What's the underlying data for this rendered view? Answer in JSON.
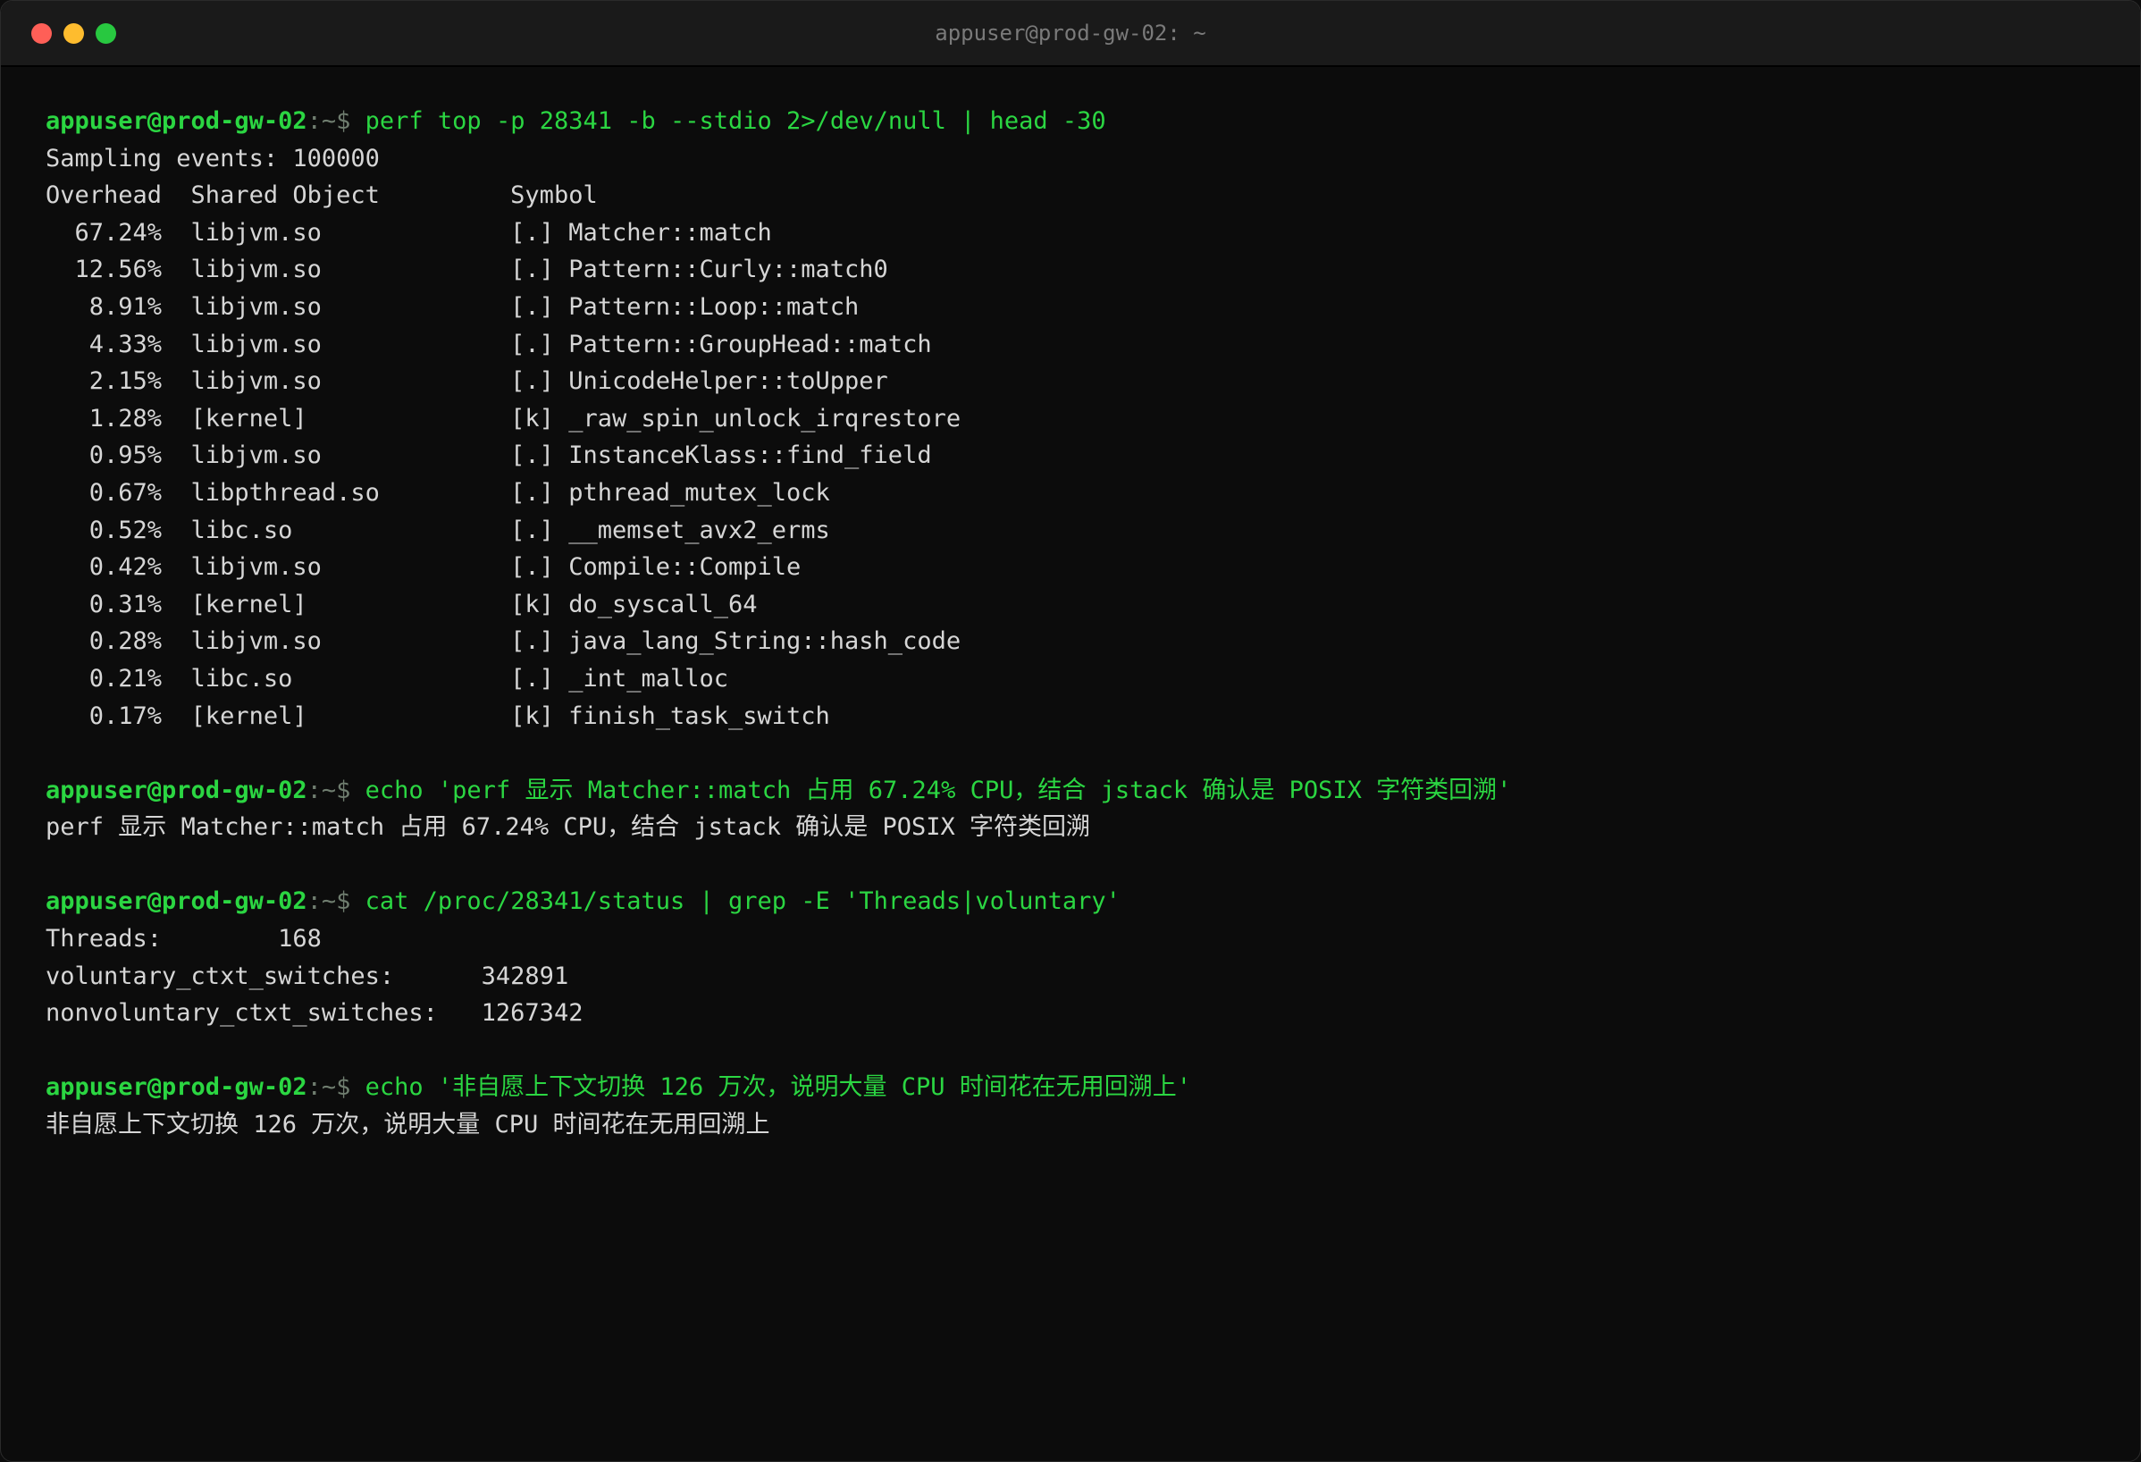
{
  "window": {
    "title": "appuser@prod-gw-02: ~",
    "colors": {
      "close": "#ff5f57",
      "minimize": "#febc2e",
      "zoom": "#28c840",
      "prompt": "#2bd642",
      "output": "#d6d6d6",
      "background": "#0c0c0c"
    }
  },
  "prompt": {
    "user_host": "appuser@prod-gw-02",
    "path": ":~$ "
  },
  "blocks": [
    {
      "command": "perf top -p 28341 -b --stdio 2>/dev/null | head -30",
      "output": [
        "Sampling events: 100000",
        "Overhead  Shared Object         Symbol",
        "  67.24%  libjvm.so             [.] Matcher::match",
        "  12.56%  libjvm.so             [.] Pattern::Curly::match0",
        "   8.91%  libjvm.so             [.] Pattern::Loop::match",
        "   4.33%  libjvm.so             [.] Pattern::GroupHead::match",
        "   2.15%  libjvm.so             [.] UnicodeHelper::toUpper",
        "   1.28%  [kernel]              [k] _raw_spin_unlock_irqrestore",
        "   0.95%  libjvm.so             [.] InstanceKlass::find_field",
        "   0.67%  libpthread.so         [.] pthread_mutex_lock",
        "   0.52%  libc.so               [.] __memset_avx2_erms",
        "   0.42%  libjvm.so             [.] Compile::Compile",
        "   0.31%  [kernel]              [k] do_syscall_64",
        "   0.28%  libjvm.so             [.] java_lang_String::hash_code",
        "   0.21%  libc.so               [.] _int_malloc",
        "   0.17%  [kernel]              [k] finish_task_switch"
      ]
    },
    {
      "command": "echo 'perf 显示 Matcher::match 占用 67.24% CPU，结合 jstack 确认是 POSIX 字符类回溯'",
      "output": [
        "perf 显示 Matcher::match 占用 67.24% CPU，结合 jstack 确认是 POSIX 字符类回溯"
      ]
    },
    {
      "command": "cat /proc/28341/status | grep -E 'Threads|voluntary'",
      "output": [
        "Threads:        168",
        "voluntary_ctxt_switches:      342891",
        "nonvoluntary_ctxt_switches:   1267342"
      ]
    },
    {
      "command": "echo '非自愿上下文切换 126 万次，说明大量 CPU 时间花在无用回溯上'",
      "output": [
        "非自愿上下文切换 126 万次，说明大量 CPU 时间花在无用回溯上"
      ]
    }
  ]
}
